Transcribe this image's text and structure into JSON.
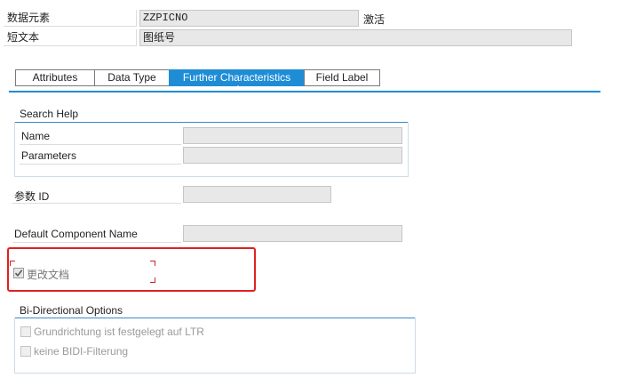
{
  "header": {
    "data_element_label": "数据元素",
    "data_element_value": "ZZPICNO",
    "status": "激活",
    "short_text_label": "短文本",
    "short_text_value": "图纸号"
  },
  "tabs": [
    {
      "label": "Attributes",
      "active": false
    },
    {
      "label": "Data Type",
      "active": false
    },
    {
      "label": "Further Characteristics",
      "active": true
    },
    {
      "label": "Field Label",
      "active": false
    }
  ],
  "search_help": {
    "title": "Search Help",
    "name_label": "Name",
    "name_value": "",
    "parameters_label": "Parameters",
    "parameters_value": ""
  },
  "parameter_id": {
    "label": "参数 ID",
    "value": ""
  },
  "default_component": {
    "label": "Default Component Name",
    "value": ""
  },
  "change_document": {
    "label": "更改文档",
    "checked": true
  },
  "bidi": {
    "title": "Bi-Directional Options",
    "option1": "Grundrichtung ist festgelegt auf LTR",
    "option2": "keine BIDI-Filterung"
  },
  "colors": {
    "accent": "#1f8dd6",
    "highlight": "#e02020",
    "field_bg": "#e8e8e8"
  }
}
